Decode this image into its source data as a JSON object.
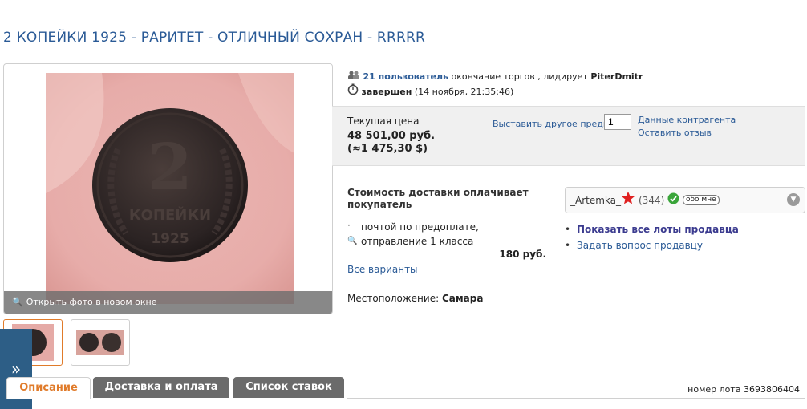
{
  "lot": {
    "title": "2 КОПЕЙКИ 1925 - РАРИТЕТ - ОТЛИЧНЫЙ СОХРАН - RRRRR",
    "number_label": "номер лота 3693806404"
  },
  "photo": {
    "open_new_window": "Открыть фото в новом окне",
    "coin_denomination": "2",
    "coin_word": "КОПЕЙКИ",
    "coin_year": "1925"
  },
  "auction": {
    "bidders_count": "21 пользователь",
    "bidders_text": " окончание торгов , лидирует ",
    "leader": "PiterDmitr",
    "status": "завершен",
    "status_date": " (14 ноября, 21:35:46)"
  },
  "price": {
    "label": "Текущая цена",
    "value": "48 501,00 руб.",
    "alt_value": "(≈1 475,30 $)",
    "bid_other_label": "Выставить другое предм.:",
    "bid_quantity": "1",
    "contractor_link": "Данные контрагента",
    "review_link": "Оставить отзыв"
  },
  "shipping": {
    "title": "Стоимость доставки оплачивает покупатель",
    "method": "почтой по предоплате, отправление 1 класса",
    "price": "180 руб.",
    "all_options": "Все варианты",
    "location_label": "Местоположение: ",
    "location_city": "Самара"
  },
  "seller": {
    "name": "_Artemka_",
    "score": "(344)",
    "about": "обо мне",
    "show_all_lots": "Показать все лоты продавца",
    "ask_question": "Задать вопрос продавцу"
  },
  "tabs": [
    {
      "label": "Описание"
    },
    {
      "label": "Доставка и оплата"
    },
    {
      "label": "Список ставок"
    }
  ],
  "side_toggle": "»",
  "colors": {
    "link_blue": "#2a5a96",
    "tab_active": "#e07b2a",
    "tab_inactive": "#6b6b6b",
    "side_panel": "#2d5e86"
  }
}
